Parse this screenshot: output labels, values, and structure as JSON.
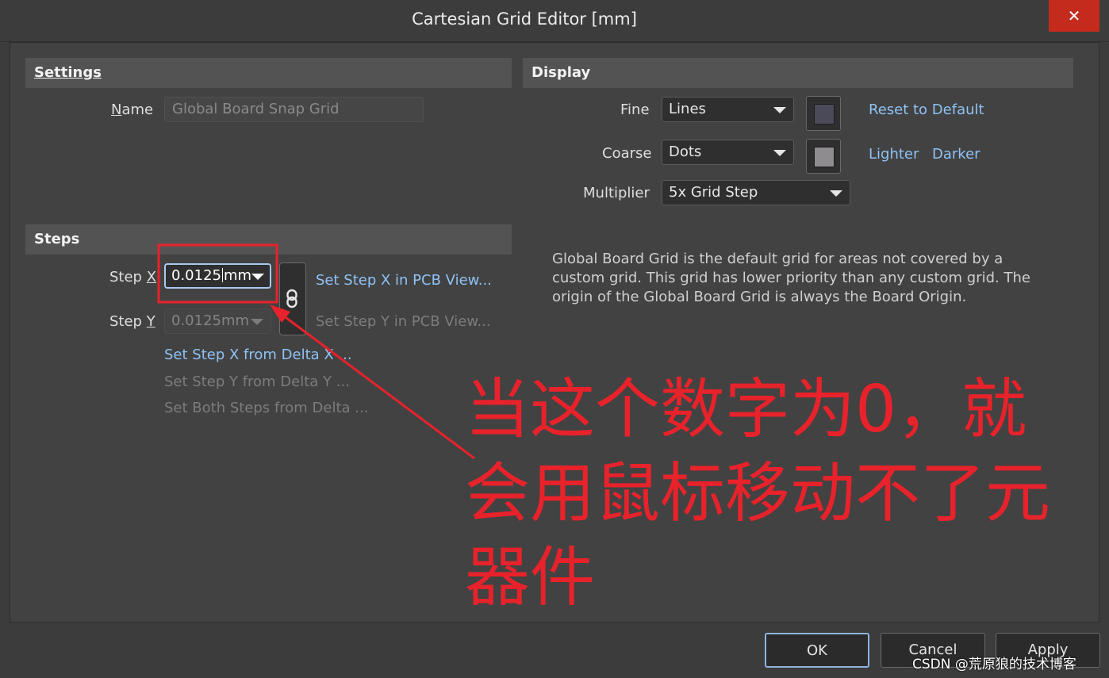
{
  "window": {
    "title": "Cartesian Grid Editor [mm]",
    "close_glyph": "✕"
  },
  "settings": {
    "header": "Settings",
    "name_label_u": "N",
    "name_label_rest": "ame",
    "name_value": "Global Board Snap Grid"
  },
  "display": {
    "header": "Display",
    "fine_label": "Fine",
    "fine_value": "Lines",
    "coarse_label": "Coarse",
    "coarse_value": "Dots",
    "multiplier_label": "Multiplier",
    "multiplier_value": "5x Grid Step",
    "fine_color": "#4a4a58",
    "coarse_color": "#8f8c90",
    "reset_link": "Reset to Default",
    "lighter_link": "Lighter",
    "darker_link": "Darker"
  },
  "steps": {
    "header": "Steps",
    "step_x_label": "Step ",
    "step_x_label_u": "X",
    "step_x_value_a": "0.0125",
    "step_x_value_b": "mm",
    "step_y_label": "Step ",
    "step_y_label_u": "Y",
    "step_y_value": "0.0125mm",
    "set_x_pcb": "Set Step X in PCB View...",
    "set_y_pcb": "Set Step Y in PCB View...",
    "set_x_delta": "Set Step X from Delta X ...",
    "set_y_delta": "Set Step Y from Delta Y ...",
    "set_both_delta": "Set Both Steps from Delta ..."
  },
  "description": {
    "line1": "Global Board Grid is the default grid for areas not covered by a",
    "line2": "custom grid. This grid has lower priority than any custom grid. The",
    "line3": "origin of the Global Board Grid is always the Board Origin."
  },
  "annotation": {
    "line1": "当这个数字为0，就",
    "line2": "会用鼠标移动不了元",
    "line3": "器件",
    "color": "#e8222b"
  },
  "footer": {
    "ok": "OK",
    "cancel": "Cancel",
    "apply": "Apply"
  },
  "watermark": "CSDN @荒原狼的技术博客"
}
